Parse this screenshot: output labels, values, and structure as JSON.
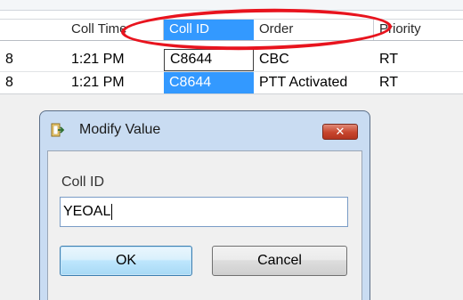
{
  "grid": {
    "columns": [
      "Coll Time",
      "Coll ID",
      "Order",
      "Priority"
    ],
    "rows": [
      {
        "first": "8",
        "coll_time": "1:21 PM",
        "coll_id": "C8644",
        "order": "CBC",
        "priority": "RT"
      },
      {
        "first": "8",
        "coll_time": "1:21 PM",
        "coll_id": "C8644",
        "order": "PTT Activated",
        "priority": "RT"
      }
    ]
  },
  "dialog": {
    "title": "Modify Value",
    "close_glyph": "✕",
    "field_label": "Coll ID",
    "field_value": "YEOAL",
    "ok_label": "OK",
    "cancel_label": "Cancel"
  },
  "colors": {
    "selection": "#3399ff",
    "annotation": "#e8141e",
    "close_button": "#c7452d",
    "dialog_frame": "#c9dcf2"
  }
}
